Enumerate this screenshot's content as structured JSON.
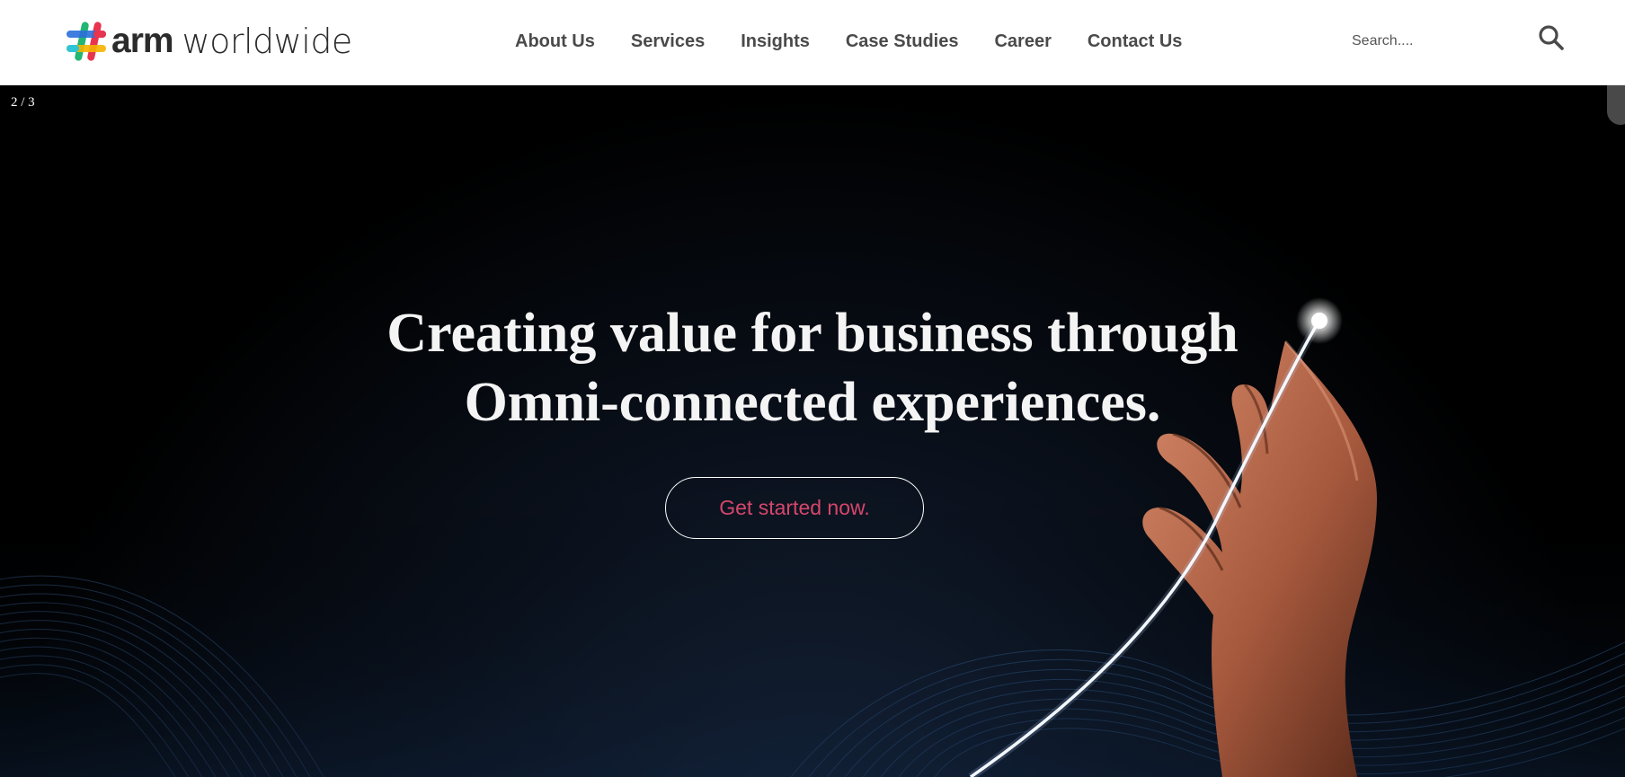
{
  "header": {
    "logo": {
      "bold": "arm",
      "light": "worldwide"
    },
    "nav": [
      {
        "label": "About Us"
      },
      {
        "label": "Services"
      },
      {
        "label": "Insights"
      },
      {
        "label": "Case Studies"
      },
      {
        "label": "Career"
      },
      {
        "label": "Contact Us"
      }
    ],
    "search": {
      "placeholder": "Search....",
      "value": "",
      "icon": "search-icon"
    }
  },
  "hero": {
    "slide_counter": "2 / 3",
    "title_line1": "Creating value for business through",
    "title_line2": "Omni-connected experiences.",
    "cta_label": "Get started now."
  },
  "colors": {
    "header_bg": "#ffffff",
    "nav_text": "#4a4a4a",
    "hero_bg": "#000000",
    "hero_title": "#f4f4f4",
    "cta_text": "#d6466b",
    "cta_border": "#ffffff",
    "logo_red": "#e8344e",
    "logo_blue": "#2a6fdb",
    "logo_green": "#22b573",
    "logo_yellow": "#f5b400",
    "logo_teal": "#2fc4d8"
  }
}
